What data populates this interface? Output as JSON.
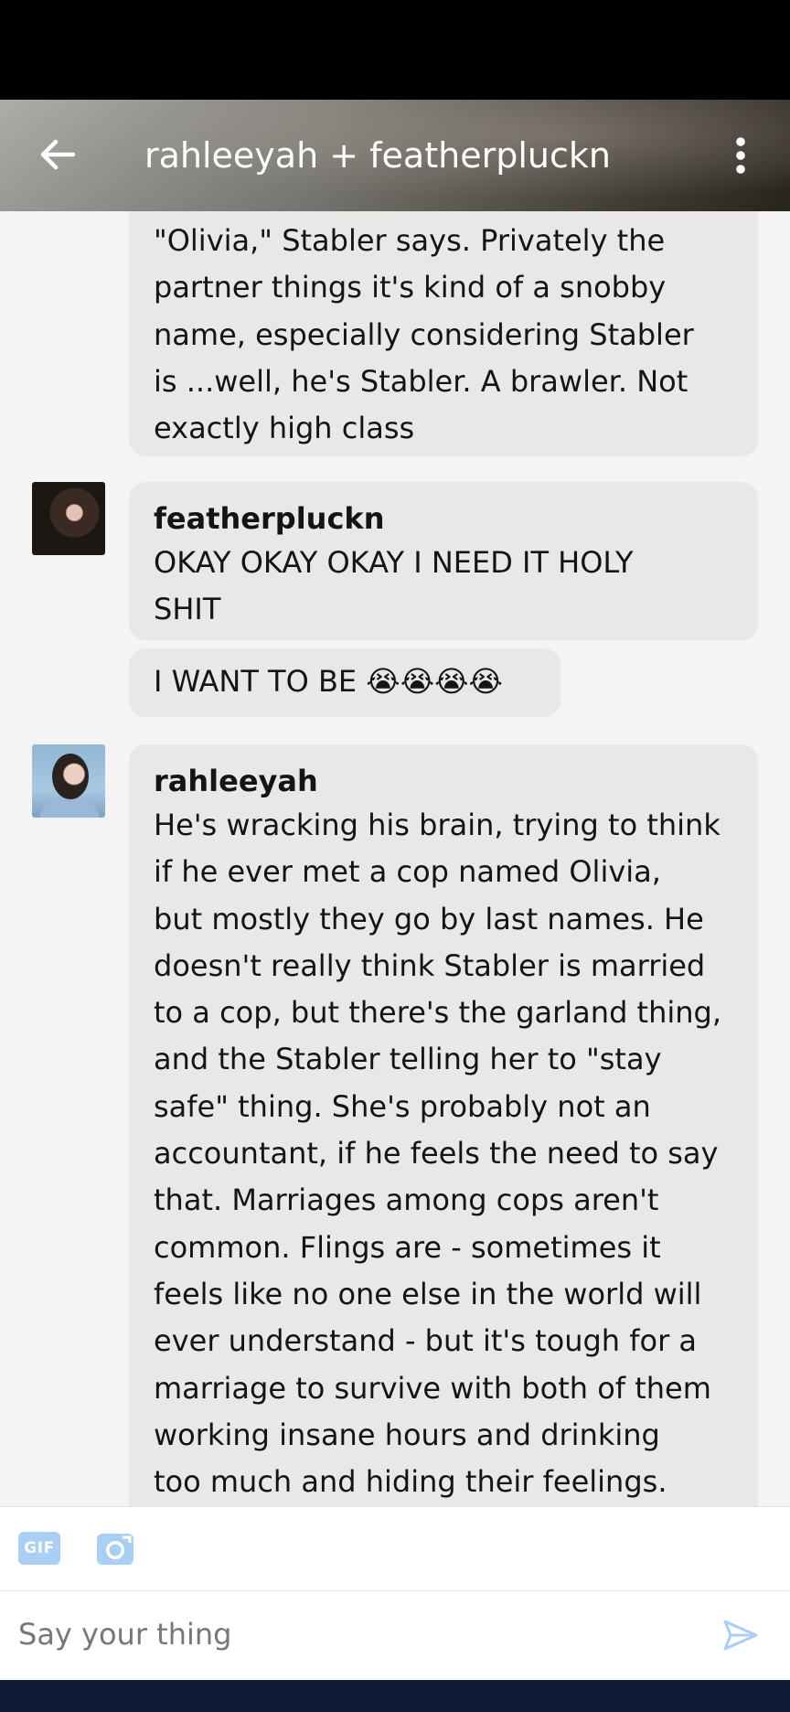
{
  "header": {
    "title": "rahleeyah + featherpluckn",
    "back_icon": "arrow-left-icon",
    "menu_icon": "more-vertical-icon"
  },
  "messages": [
    {
      "sender": "",
      "paragraphs": [
        "\"Olivia,\" Stabler says. Privately the",
        "partner things it's kind of a snobby",
        "name, especially considering Stabler",
        "is ...well, he's Stabler. A brawler. Not",
        "exactly high class"
      ]
    },
    {
      "sender": "featherpluckn",
      "lines": [
        "OKAY OKAY OKAY I NEED IT HOLY",
        "SHIT"
      ]
    },
    {
      "sender": "",
      "lines": [
        "I WANT TO BE 😭😭😭😭"
      ]
    },
    {
      "sender": "rahleeyah",
      "lines": [
        "He's wracking his brain, trying to think",
        "if he ever met a cop named Olivia,",
        "but mostly they go by last names. He",
        "doesn't really think Stabler is married",
        "to a cop, but there's the garland thing,",
        "and the Stabler telling her to \"stay",
        "safe\" thing. She's probably not an",
        "accountant, if he feels the need to say",
        "that. Marriages among cops aren't",
        "common. Flings are - sometimes it",
        "feels like no one else in the world will",
        "ever understand - but it's tough for a",
        "marriage to survive with both of them",
        "working insane hours and drinking",
        "too much and hiding their feelings."
      ]
    }
  ],
  "toolbar": {
    "gif_label": "GIF",
    "camera_icon": "camera-icon"
  },
  "composer": {
    "placeholder": "Say your thing",
    "send_icon": "send-icon"
  },
  "colors": {
    "bubble": "#e8e8e8",
    "background": "#f4f4f4",
    "accent": "#a9cff5",
    "nav": "#0d1a33"
  }
}
